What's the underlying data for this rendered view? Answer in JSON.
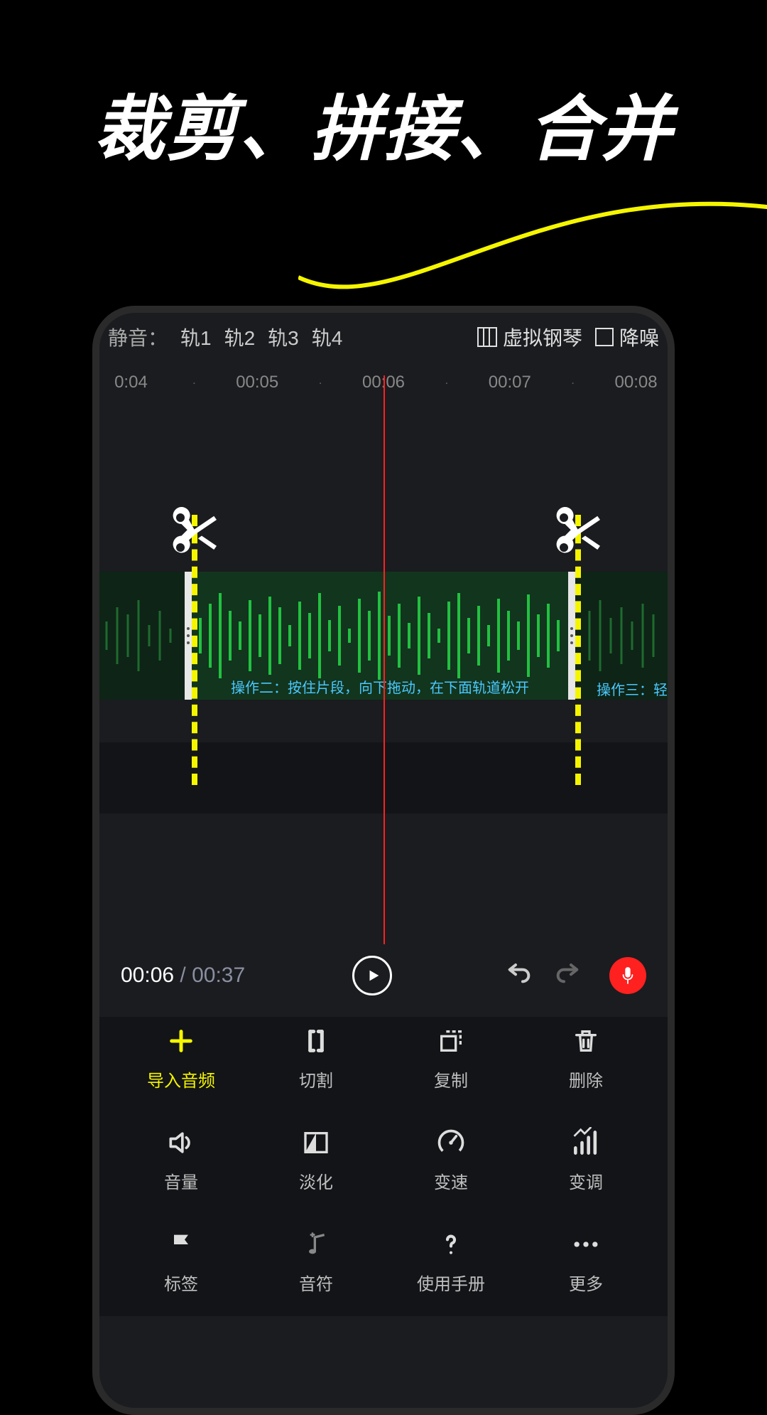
{
  "headline": "裁剪、拼接、合并",
  "top": {
    "mute_label": "静音：",
    "tracks": [
      "轨1",
      "轨2",
      "轨3",
      "轨4"
    ],
    "virtual_piano": "虚拟钢琴",
    "noise_reduce": "降噪"
  },
  "ruler": [
    "0:04",
    "·",
    "00:05",
    "·",
    "00:06",
    "·",
    "00:07",
    "·",
    "00:08"
  ],
  "clip_caption": "操作二：按住片段，向下拖动，在下面轨道松开",
  "side_caption": "操作三：轻轻",
  "time": {
    "current": "00:06",
    "sep": " / ",
    "total": "00:37"
  },
  "tools": [
    {
      "id": "import",
      "label": "导入音频",
      "accent": true
    },
    {
      "id": "split",
      "label": "切割"
    },
    {
      "id": "copy",
      "label": "复制"
    },
    {
      "id": "delete",
      "label": "删除"
    },
    {
      "id": "volume",
      "label": "音量"
    },
    {
      "id": "fade",
      "label": "淡化"
    },
    {
      "id": "speed",
      "label": "变速"
    },
    {
      "id": "pitch",
      "label": "变调"
    },
    {
      "id": "marker",
      "label": "标签"
    },
    {
      "id": "note",
      "label": "音符"
    },
    {
      "id": "manual",
      "label": "使用手册"
    },
    {
      "id": "more",
      "label": "更多"
    }
  ]
}
